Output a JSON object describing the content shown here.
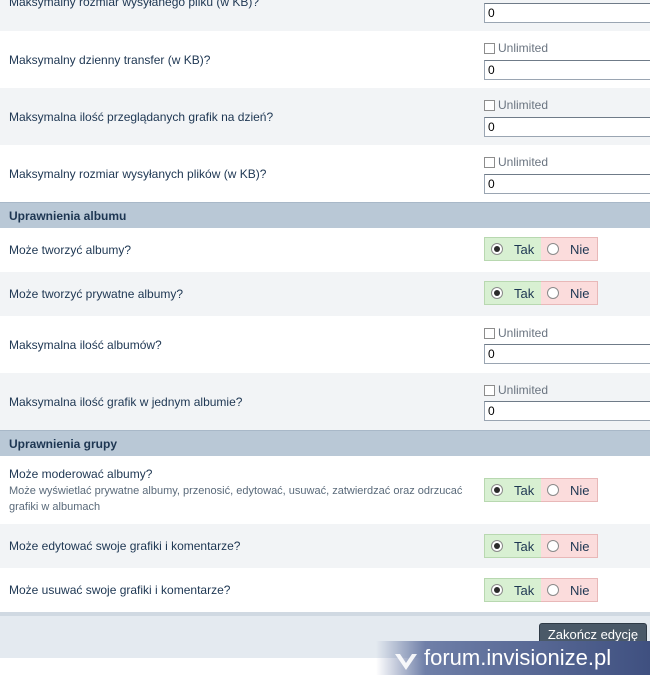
{
  "rows_upload": [
    {
      "label": "Maksymalny rozmiar wysyłanego pliku (w KB)?",
      "value": "0"
    },
    {
      "label": "Maksymalny dzienny transfer (w KB)?",
      "unlimited": "Unlimited",
      "value": "0"
    },
    {
      "label": "Maksymalna ilość przeglądanych grafik na dzień?",
      "unlimited": "Unlimited",
      "value": "0"
    },
    {
      "label": "Maksymalny rozmiar wysyłanych plików (w KB)?",
      "unlimited": "Unlimited",
      "value": "0"
    }
  ],
  "section_album": {
    "title": "Uprawnienia albumu",
    "rows": [
      {
        "label": "Może tworzyć albumy?",
        "yes": "Tak",
        "no": "Nie"
      },
      {
        "label": "Może tworzyć prywatne albumy?",
        "yes": "Tak",
        "no": "Nie"
      },
      {
        "label": "Maksymalna ilość albumów?",
        "unlimited": "Unlimited",
        "value": "0"
      },
      {
        "label": "Maksymalna ilość grafik w jednym albumie?",
        "unlimited": "Unlimited",
        "value": "0"
      }
    ]
  },
  "section_group": {
    "title": "Uprawnienia grupy",
    "rows": [
      {
        "label": "Może moderować albumy?",
        "description": "Może wyświetlać prywatne albumy, przenosić, edytować, usuwać, zatwierdzać oraz odrzucać grafiki w albumach",
        "yes": "Tak",
        "no": "Nie"
      },
      {
        "label": "Może edytować swoje grafiki i komentarze?",
        "yes": "Tak",
        "no": "Nie"
      },
      {
        "label": "Może usuwać swoje grafiki i komentarze?",
        "yes": "Tak",
        "no": "Nie"
      }
    ]
  },
  "footer": {
    "submit_label": "Zakończ edycję"
  },
  "watermark": {
    "text": "forum.invisionize.pl"
  },
  "colors": {
    "section_bg": "#b9c8d6",
    "yes_bg": "#d8f0d2",
    "no_bg": "#fbdcdc",
    "button_bg": "#4a5968"
  }
}
